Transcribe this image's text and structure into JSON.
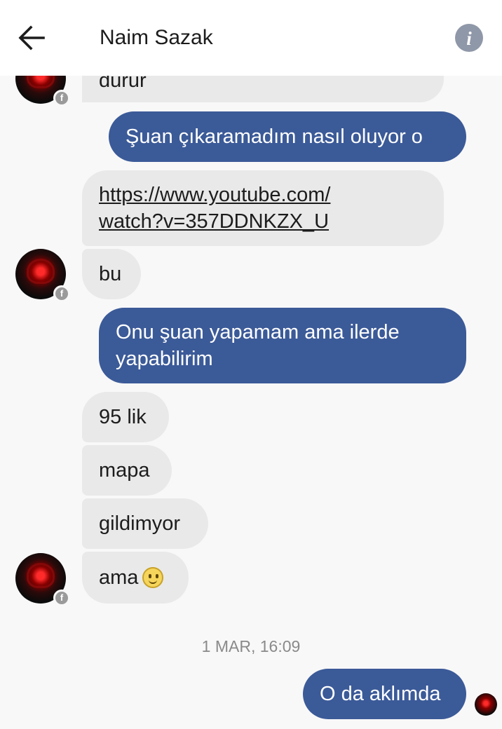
{
  "header": {
    "contact_name": "Naim Sazak",
    "back_icon": "arrow-left-icon",
    "info_icon": "info-icon",
    "info_glyph": "i"
  },
  "messages": {
    "m0": "durur",
    "m1": "Şuan çıkaramadım nasıl oluyor o",
    "m2_line1": "https://www.youtube.com/",
    "m2_line2": "watch?v=357DDNKZX_U",
    "m3": "bu",
    "m4_line1": "Onu şuan yapamam ama ilerde",
    "m4_line2": "yapabilirim",
    "m5": "95 lik",
    "m6": "mapa",
    "m7": "gildimyor",
    "m8": "ama"
  },
  "badge_glyph": "f",
  "timestamp": "1 MAR, 16:09",
  "last_message": "O da aklımda",
  "colors": {
    "outgoing_bubble": "#3b5a98",
    "incoming_bubble": "#e9e9e9",
    "background": "#f8f8f8"
  }
}
